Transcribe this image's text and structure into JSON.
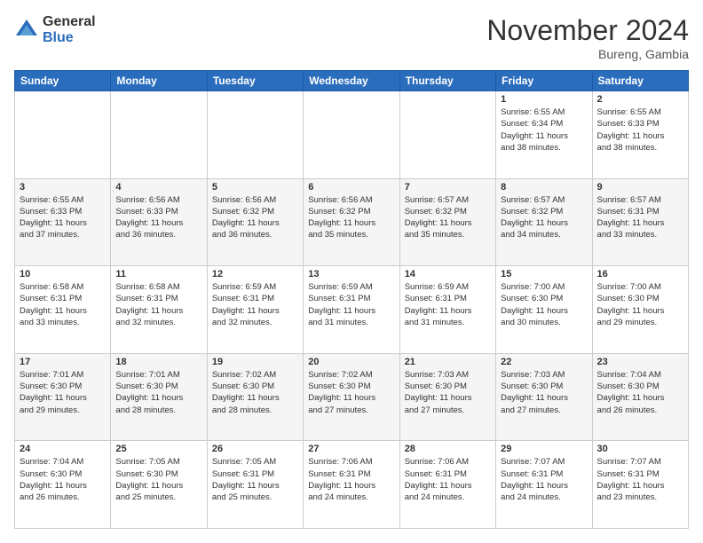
{
  "header": {
    "logo_general": "General",
    "logo_blue": "Blue",
    "month_title": "November 2024",
    "location": "Bureng, Gambia"
  },
  "weekdays": [
    "Sunday",
    "Monday",
    "Tuesday",
    "Wednesday",
    "Thursday",
    "Friday",
    "Saturday"
  ],
  "weeks": [
    [
      {
        "day": "",
        "info": ""
      },
      {
        "day": "",
        "info": ""
      },
      {
        "day": "",
        "info": ""
      },
      {
        "day": "",
        "info": ""
      },
      {
        "day": "",
        "info": ""
      },
      {
        "day": "1",
        "info": "Sunrise: 6:55 AM\nSunset: 6:34 PM\nDaylight: 11 hours\nand 38 minutes."
      },
      {
        "day": "2",
        "info": "Sunrise: 6:55 AM\nSunset: 6:33 PM\nDaylight: 11 hours\nand 38 minutes."
      }
    ],
    [
      {
        "day": "3",
        "info": "Sunrise: 6:55 AM\nSunset: 6:33 PM\nDaylight: 11 hours\nand 37 minutes."
      },
      {
        "day": "4",
        "info": "Sunrise: 6:56 AM\nSunset: 6:33 PM\nDaylight: 11 hours\nand 36 minutes."
      },
      {
        "day": "5",
        "info": "Sunrise: 6:56 AM\nSunset: 6:32 PM\nDaylight: 11 hours\nand 36 minutes."
      },
      {
        "day": "6",
        "info": "Sunrise: 6:56 AM\nSunset: 6:32 PM\nDaylight: 11 hours\nand 35 minutes."
      },
      {
        "day": "7",
        "info": "Sunrise: 6:57 AM\nSunset: 6:32 PM\nDaylight: 11 hours\nand 35 minutes."
      },
      {
        "day": "8",
        "info": "Sunrise: 6:57 AM\nSunset: 6:32 PM\nDaylight: 11 hours\nand 34 minutes."
      },
      {
        "day": "9",
        "info": "Sunrise: 6:57 AM\nSunset: 6:31 PM\nDaylight: 11 hours\nand 33 minutes."
      }
    ],
    [
      {
        "day": "10",
        "info": "Sunrise: 6:58 AM\nSunset: 6:31 PM\nDaylight: 11 hours\nand 33 minutes."
      },
      {
        "day": "11",
        "info": "Sunrise: 6:58 AM\nSunset: 6:31 PM\nDaylight: 11 hours\nand 32 minutes."
      },
      {
        "day": "12",
        "info": "Sunrise: 6:59 AM\nSunset: 6:31 PM\nDaylight: 11 hours\nand 32 minutes."
      },
      {
        "day": "13",
        "info": "Sunrise: 6:59 AM\nSunset: 6:31 PM\nDaylight: 11 hours\nand 31 minutes."
      },
      {
        "day": "14",
        "info": "Sunrise: 6:59 AM\nSunset: 6:31 PM\nDaylight: 11 hours\nand 31 minutes."
      },
      {
        "day": "15",
        "info": "Sunrise: 7:00 AM\nSunset: 6:30 PM\nDaylight: 11 hours\nand 30 minutes."
      },
      {
        "day": "16",
        "info": "Sunrise: 7:00 AM\nSunset: 6:30 PM\nDaylight: 11 hours\nand 29 minutes."
      }
    ],
    [
      {
        "day": "17",
        "info": "Sunrise: 7:01 AM\nSunset: 6:30 PM\nDaylight: 11 hours\nand 29 minutes."
      },
      {
        "day": "18",
        "info": "Sunrise: 7:01 AM\nSunset: 6:30 PM\nDaylight: 11 hours\nand 28 minutes."
      },
      {
        "day": "19",
        "info": "Sunrise: 7:02 AM\nSunset: 6:30 PM\nDaylight: 11 hours\nand 28 minutes."
      },
      {
        "day": "20",
        "info": "Sunrise: 7:02 AM\nSunset: 6:30 PM\nDaylight: 11 hours\nand 27 minutes."
      },
      {
        "day": "21",
        "info": "Sunrise: 7:03 AM\nSunset: 6:30 PM\nDaylight: 11 hours\nand 27 minutes."
      },
      {
        "day": "22",
        "info": "Sunrise: 7:03 AM\nSunset: 6:30 PM\nDaylight: 11 hours\nand 27 minutes."
      },
      {
        "day": "23",
        "info": "Sunrise: 7:04 AM\nSunset: 6:30 PM\nDaylight: 11 hours\nand 26 minutes."
      }
    ],
    [
      {
        "day": "24",
        "info": "Sunrise: 7:04 AM\nSunset: 6:30 PM\nDaylight: 11 hours\nand 26 minutes."
      },
      {
        "day": "25",
        "info": "Sunrise: 7:05 AM\nSunset: 6:30 PM\nDaylight: 11 hours\nand 25 minutes."
      },
      {
        "day": "26",
        "info": "Sunrise: 7:05 AM\nSunset: 6:31 PM\nDaylight: 11 hours\nand 25 minutes."
      },
      {
        "day": "27",
        "info": "Sunrise: 7:06 AM\nSunset: 6:31 PM\nDaylight: 11 hours\nand 24 minutes."
      },
      {
        "day": "28",
        "info": "Sunrise: 7:06 AM\nSunset: 6:31 PM\nDaylight: 11 hours\nand 24 minutes."
      },
      {
        "day": "29",
        "info": "Sunrise: 7:07 AM\nSunset: 6:31 PM\nDaylight: 11 hours\nand 24 minutes."
      },
      {
        "day": "30",
        "info": "Sunrise: 7:07 AM\nSunset: 6:31 PM\nDaylight: 11 hours\nand 23 minutes."
      }
    ]
  ]
}
